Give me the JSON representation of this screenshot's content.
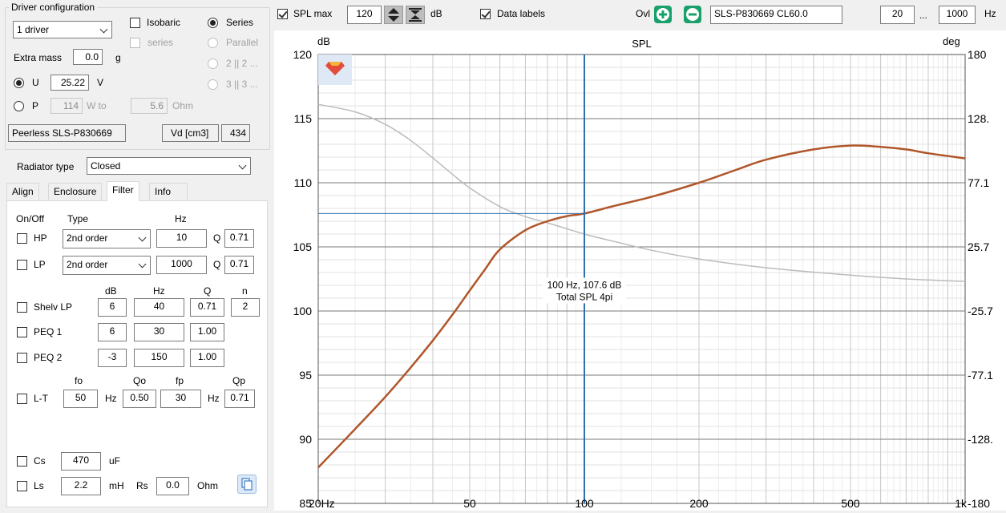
{
  "driver_config": {
    "title": "Driver configuration",
    "driver_count": "1 driver",
    "isobaric_label": "Isobaric",
    "isobaric_series_label": "series",
    "series_label": "Series",
    "parallel_label": "Parallel",
    "opt_2_label": "2 || 2 ...",
    "opt_3_label": "3 || 3 ...",
    "extra_mass_label": "Extra mass",
    "extra_mass_value": "0.0",
    "extra_mass_unit": "g",
    "u_label": "U",
    "u_value": "25.22",
    "u_unit": "V",
    "p_label": "P",
    "p_value": "114",
    "p_unit": "W to",
    "ohm_value": "5.6",
    "ohm_unit": "Ohm",
    "driver_name": "Peerless SLS-P830669",
    "vd_label": "Vd [cm3]",
    "vd_value": "434"
  },
  "radiator": {
    "label": "Radiator type",
    "value": "Closed"
  },
  "tabs": [
    "Align",
    "Enclosure",
    "Filter",
    "Info"
  ],
  "filter": {
    "header_onoff": "On/Off",
    "header_type": "Type",
    "header_hz": "Hz",
    "hp": {
      "label": "HP",
      "type": "2nd order",
      "hz": "10",
      "q_label": "Q",
      "q": "0.71"
    },
    "lp": {
      "label": "LP",
      "type": "2nd order",
      "hz": "1000",
      "q_label": "Q",
      "q": "0.71"
    },
    "col_db": "dB",
    "col_hz": "Hz",
    "col_q": "Q",
    "col_n": "n",
    "shelv": {
      "label": "Shelv LP",
      "db": "6",
      "hz": "40",
      "q": "0.71",
      "n": "2"
    },
    "peq1": {
      "label": "PEQ 1",
      "db": "6",
      "hz": "30",
      "q": "1.00"
    },
    "peq2": {
      "label": "PEQ 2",
      "db": "-3",
      "hz": "150",
      "q": "1.00"
    },
    "lt_col_fo": "fo",
    "lt_col_qo": "Qo",
    "lt_col_fp": "fp",
    "lt_col_qp": "Qp",
    "lt": {
      "label": "L-T",
      "fo": "50",
      "hz1": "Hz",
      "qo": "0.50",
      "fp": "30",
      "hz2": "Hz",
      "qp": "0.71"
    },
    "cs": {
      "label": "Cs",
      "value": "470",
      "unit": "uF"
    },
    "ls": {
      "label": "Ls",
      "value": "2.2",
      "unit": "mH",
      "rs_label": "Rs",
      "rs_value": "0.0",
      "rs_unit": "Ohm"
    }
  },
  "toolbar": {
    "spl_max_label": "SPL max",
    "spl_max_value": "120",
    "db_unit": "dB",
    "data_labels": "Data labels",
    "ovl_label": "Ovl",
    "overlay_name": "SLS-P830669 CL60.0",
    "freq_min": "20",
    "range_sep": "...",
    "freq_max": "1000",
    "hz_unit": "Hz"
  },
  "colors": {
    "spl": "#b0562a",
    "phase": "#bbbbbb",
    "cursor": "#2e6fb0",
    "add_btn": "#1aa06b",
    "remove_btn": "#1aa06b"
  },
  "chart_data": {
    "type": "line",
    "title": "SPL",
    "y_left_label": "dB",
    "y_right_label": "deg",
    "x_scale": "log",
    "xlim": [
      20,
      1000
    ],
    "ylim": [
      85,
      120
    ],
    "y2lim": [
      -180,
      180
    ],
    "x_ticks": [
      {
        "v": 20,
        "label": "20Hz"
      },
      {
        "v": 50,
        "label": "50"
      },
      {
        "v": 100,
        "label": "100"
      },
      {
        "v": 200,
        "label": "200"
      },
      {
        "v": 500,
        "label": "500"
      },
      {
        "v": 1000,
        "label": "1k"
      }
    ],
    "y_ticks": [
      85,
      90,
      95,
      100,
      105,
      110,
      115,
      120
    ],
    "y2_ticks": [
      "-180",
      "-128.",
      "-77.1",
      "-25.7",
      "25.7",
      "77.1",
      "128.",
      "180"
    ],
    "grid": true,
    "series": [
      {
        "key": "spl",
        "x": [
          20,
          25,
          30,
          35,
          40,
          45,
          50,
          55,
          60,
          70,
          80,
          90,
          100,
          120,
          150,
          200,
          250,
          300,
          400,
          500,
          600,
          700,
          800,
          1000
        ],
        "y": [
          87.8,
          90.8,
          93.3,
          95.6,
          97.7,
          99.7,
          101.6,
          103.3,
          104.8,
          106.3,
          107.0,
          107.4,
          107.6,
          108.2,
          108.9,
          110.0,
          111.0,
          111.8,
          112.6,
          112.9,
          112.8,
          112.6,
          112.3,
          111.9
        ]
      },
      {
        "key": "phase",
        "axis": "right",
        "x": [
          20,
          25,
          30,
          35,
          40,
          45,
          50,
          60,
          70,
          80,
          100,
          120,
          150,
          200,
          300,
          500,
          700,
          1000
        ],
        "y": [
          140,
          134,
          124,
          111,
          97,
          84,
          73,
          58,
          50,
          45,
          36,
          30,
          23,
          16,
          9,
          3,
          0,
          -2
        ]
      }
    ],
    "cursor": {
      "x": 100,
      "y": 107.6,
      "label1": "100 Hz, 107.6 dB",
      "label2": "Total SPL 4pi"
    }
  }
}
